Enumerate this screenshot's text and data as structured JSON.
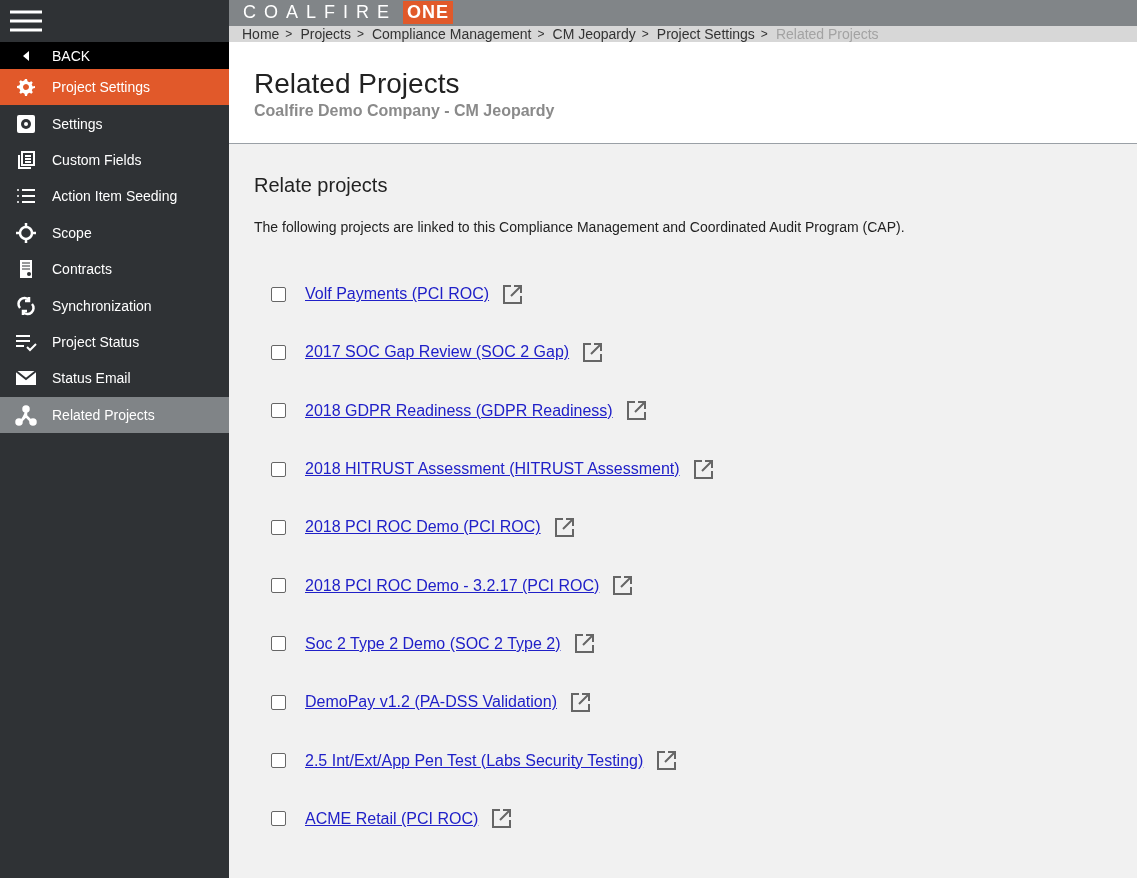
{
  "logo": {
    "name": "COALFIRE",
    "badge": "ONE"
  },
  "sidebar": {
    "back": "BACK",
    "header": "Project Settings",
    "items": [
      {
        "label": "Settings",
        "selected": false
      },
      {
        "label": "Custom Fields",
        "selected": false
      },
      {
        "label": "Action Item Seeding",
        "selected": false
      },
      {
        "label": "Scope",
        "selected": false
      },
      {
        "label": "Contracts",
        "selected": false
      },
      {
        "label": "Synchronization",
        "selected": false
      },
      {
        "label": "Project Status",
        "selected": false
      },
      {
        "label": "Status Email",
        "selected": false
      },
      {
        "label": "Related Projects",
        "selected": true
      }
    ]
  },
  "breadcrumb": {
    "separator": ">",
    "items": [
      {
        "label": "Home",
        "current": false
      },
      {
        "label": "Projects",
        "current": false
      },
      {
        "label": "Compliance Management",
        "current": false
      },
      {
        "label": "CM Jeopardy",
        "current": false
      },
      {
        "label": "Project Settings",
        "current": false
      },
      {
        "label": "Related Projects",
        "current": true
      }
    ]
  },
  "page": {
    "title": "Related Projects",
    "subtitle": "Coalfire Demo Company - CM Jeopardy"
  },
  "section": {
    "title": "Relate projects",
    "description": "The following projects are linked to this Compliance Management and Coordinated Audit Program (CAP).",
    "projects": [
      {
        "label": "Volf Payments (PCI ROC)",
        "checked": false
      },
      {
        "label": "2017 SOC Gap Review (SOC 2 Gap)",
        "checked": false
      },
      {
        "label": "2018 GDPR Readiness (GDPR Readiness)",
        "checked": false
      },
      {
        "label": "2018 HITRUST Assessment (HITRUST Assessment)",
        "checked": false
      },
      {
        "label": "2018 PCI ROC Demo (PCI ROC)",
        "checked": false
      },
      {
        "label": "2018 PCI ROC Demo - 3.2.17 (PCI ROC)",
        "checked": false
      },
      {
        "label": "Soc 2 Type 2 Demo (SOC 2 Type 2)",
        "checked": false
      },
      {
        "label": "DemoPay v1.2 (PA-DSS Validation)",
        "checked": false
      },
      {
        "label": "2.5 Int/Ext/App Pen Test (Labs Security Testing)",
        "checked": false
      },
      {
        "label": "ACME Retail (PCI ROC)",
        "checked": false
      }
    ]
  }
}
